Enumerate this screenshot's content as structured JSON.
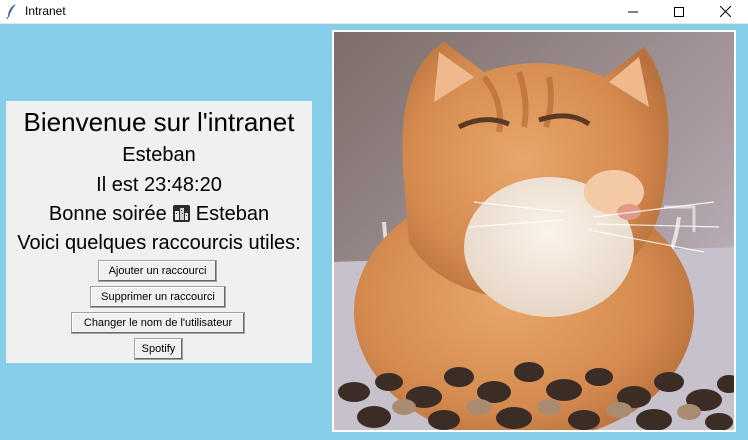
{
  "window": {
    "title": "Intranet",
    "app_icon": "feather-icon",
    "controls": [
      "minimize-icon",
      "maximize-icon",
      "close-icon"
    ]
  },
  "panel": {
    "welcome": "Bienvenue sur l'intranet",
    "username": "Esteban",
    "clock": "Il est 23:48:20",
    "greeting_prefix": "Bonne soirée",
    "greeting_icon": "night-city-icon",
    "greeting_name": "Esteban",
    "shortcuts_heading": "Voici quelques raccourcis utiles:"
  },
  "buttons": {
    "add": "Ajouter un raccourci",
    "remove": "Supprimer un raccourci",
    "rename": "Changer le nom de l'utilisateur",
    "spotify": "Spotify"
  },
  "colors": {
    "background": "#87ceeb",
    "panel": "#f0f0f0"
  }
}
